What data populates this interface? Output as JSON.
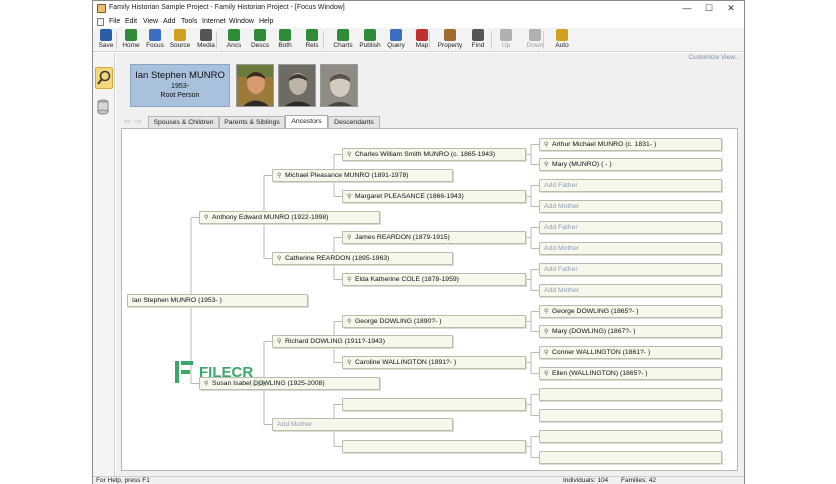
{
  "window": {
    "title": "Family Historian Sample Project - Family Historian Project - [Focus Window]",
    "minimize": "—",
    "maximize": "☐",
    "close": "✕"
  },
  "menu": [
    "File",
    "Edit",
    "View",
    "Add",
    "Tools",
    "Internet",
    "Window",
    "Help"
  ],
  "toolbar": {
    "buttons": [
      {
        "label": "Save",
        "icon": "save-icon",
        "color": "#2c5ea8"
      },
      {
        "label": "Home",
        "icon": "home-icon",
        "color": "#2f8a3a"
      },
      {
        "label": "Focus",
        "icon": "focus-icon",
        "color": "#3a6fc0"
      },
      {
        "label": "Source",
        "icon": "source-icon",
        "color": "#d0a020"
      },
      {
        "label": "Media",
        "icon": "media-icon",
        "color": "#555555"
      },
      {
        "label": "Ancs",
        "icon": "ancestors-icon",
        "color": "#2f8a3a"
      },
      {
        "label": "Descs",
        "icon": "descendants-icon",
        "color": "#2f8a3a"
      },
      {
        "label": "Both",
        "icon": "both-icon",
        "color": "#2f8a3a"
      },
      {
        "label": "Rels",
        "icon": "relatives-icon",
        "color": "#2f8a3a"
      },
      {
        "label": "Charts",
        "icon": "charts-icon",
        "color": "#2f8a3a"
      },
      {
        "label": "Publish",
        "icon": "publish-icon",
        "color": "#2f8a3a"
      },
      {
        "label": "Query",
        "icon": "query-icon",
        "color": "#3a6fc0"
      },
      {
        "label": "Map",
        "icon": "map-icon",
        "color": "#c03030"
      },
      {
        "label": "Property",
        "icon": "property-icon",
        "color": "#a06a30"
      },
      {
        "label": "Find",
        "icon": "find-icon",
        "color": "#555555"
      },
      {
        "label": "Up",
        "icon": "up-arrow-icon",
        "color": "#b0b0b0"
      },
      {
        "label": "Down",
        "icon": "down-arrow-icon",
        "color": "#b0b0b0"
      },
      {
        "label": "Auto",
        "icon": "auto-icon",
        "color": "#d0a020"
      }
    ]
  },
  "customize_view": "Customize View...",
  "focus": {
    "name": "Ian Stephen MUNRO",
    "dates": "1953-",
    "role": "Root Person"
  },
  "tabs": [
    "Spouses & Children",
    "Parents & Siblings",
    "Ancestors",
    "Descendants"
  ],
  "active_tab": "Ancestors",
  "tree": {
    "gen1": [
      {
        "name": "Ian Stephen MUNRO (1953- )"
      }
    ],
    "gen2": [
      {
        "name": "Anthony Edward MUNRO (1922-1998)"
      },
      {
        "name": "Susan Isabel DOWLING (1925-2008)"
      }
    ],
    "gen3": [
      {
        "name": "Michael Pleasance MUNRO (1891-1978)"
      },
      {
        "name": "Catherine REARDON (1895-1963)"
      },
      {
        "name": "Richard DOWLING (1911?-1943)"
      },
      {
        "name": "Add Mother"
      }
    ],
    "gen4": [
      {
        "name": "Charles William Smith MUNRO (c. 1865-1943)"
      },
      {
        "name": "Margaret PLEASANCE (1866-1943)"
      },
      {
        "name": "James REARDON (1879-1915)"
      },
      {
        "name": "Elda Katherine COLE (1878-1959)"
      },
      {
        "name": "George DOWLING (1890?- )"
      },
      {
        "name": "Caroline WALLINGTON (1891?- )"
      },
      {
        "name": ""
      },
      {
        "name": ""
      }
    ],
    "gen5": [
      {
        "name": "Arthur Michael MUNRO (c. 1831- )"
      },
      {
        "name": "Mary (MUNRO) ( - )"
      },
      {
        "name": "Add Father"
      },
      {
        "name": "Add Mother"
      },
      {
        "name": "Add Father"
      },
      {
        "name": "Add Mother"
      },
      {
        "name": "Add Father"
      },
      {
        "name": "Add Mother"
      },
      {
        "name": "George DOWLING (1865?- )"
      },
      {
        "name": "Mary (DOWLING) (1867?- )"
      },
      {
        "name": "Conner WALLINGTON (1861?- )"
      },
      {
        "name": "Ellen (WALLINGTON) (1865?- )"
      },
      {
        "name": ""
      },
      {
        "name": ""
      },
      {
        "name": ""
      },
      {
        "name": ""
      }
    ]
  },
  "watermark": {
    "brand": "FILECR",
    "suffix": ".com"
  },
  "status": {
    "help": "For Help, press F1",
    "individuals": "Individuals: 104",
    "families": "Families: 42"
  }
}
